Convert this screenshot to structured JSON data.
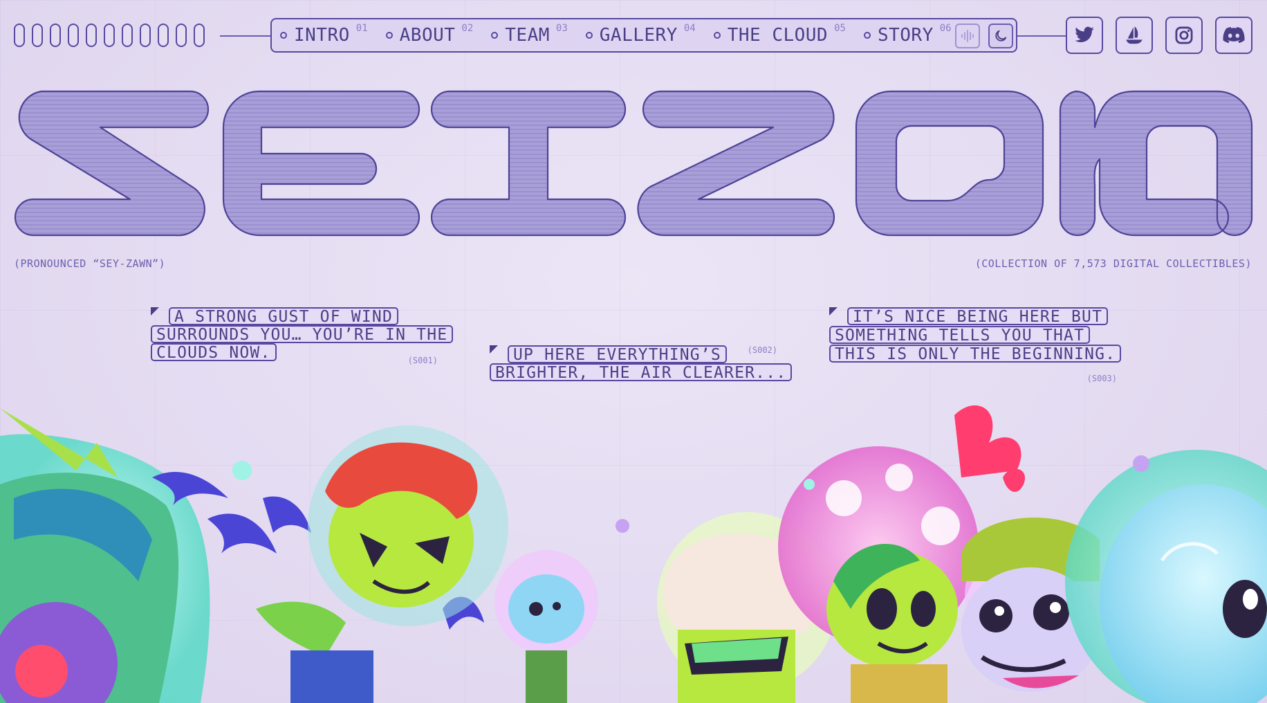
{
  "nav": {
    "items": [
      {
        "label": "INTRO",
        "num": "01"
      },
      {
        "label": "ABOUT",
        "num": "02"
      },
      {
        "label": "TEAM",
        "num": "03"
      },
      {
        "label": "GALLERY",
        "num": "04"
      },
      {
        "label": "THE CLOUD",
        "num": "05"
      },
      {
        "label": "STORY",
        "num": "06"
      }
    ],
    "sound_icon": "sound-wave-icon",
    "theme_icon": "moon-icon"
  },
  "social": {
    "icons": [
      "twitter-icon",
      "opensea-icon",
      "instagram-icon",
      "discord-icon"
    ]
  },
  "hero": {
    "title": "SEIZON",
    "pronunciation": "(PRONOUNCED “SEY-ZAWN”)",
    "collection": "(COLLECTION OF 7,573 DIGITAL COLLECTIBLES)"
  },
  "captions": [
    {
      "lines": [
        "A STRONG GUST OF WIND",
        "SURROUNDS YOU… YOU’RE IN THE",
        "CLOUDS NOW."
      ],
      "code": "(S001)"
    },
    {
      "lines": [
        "UP HERE EVERYTHING’S",
        "BRIGHTER, THE AIR CLEARER..."
      ],
      "code": "(S002)"
    },
    {
      "lines": [
        "IT’S NICE BEING HERE BUT",
        "SOMETHING TELLS YOU THAT",
        "THIS IS ONLY THE BEGINNING."
      ],
      "code": "(S003)"
    }
  ],
  "colors": {
    "background": "#e6def3",
    "ink": "#4a3f86",
    "title_fill": "#a79fd6"
  }
}
